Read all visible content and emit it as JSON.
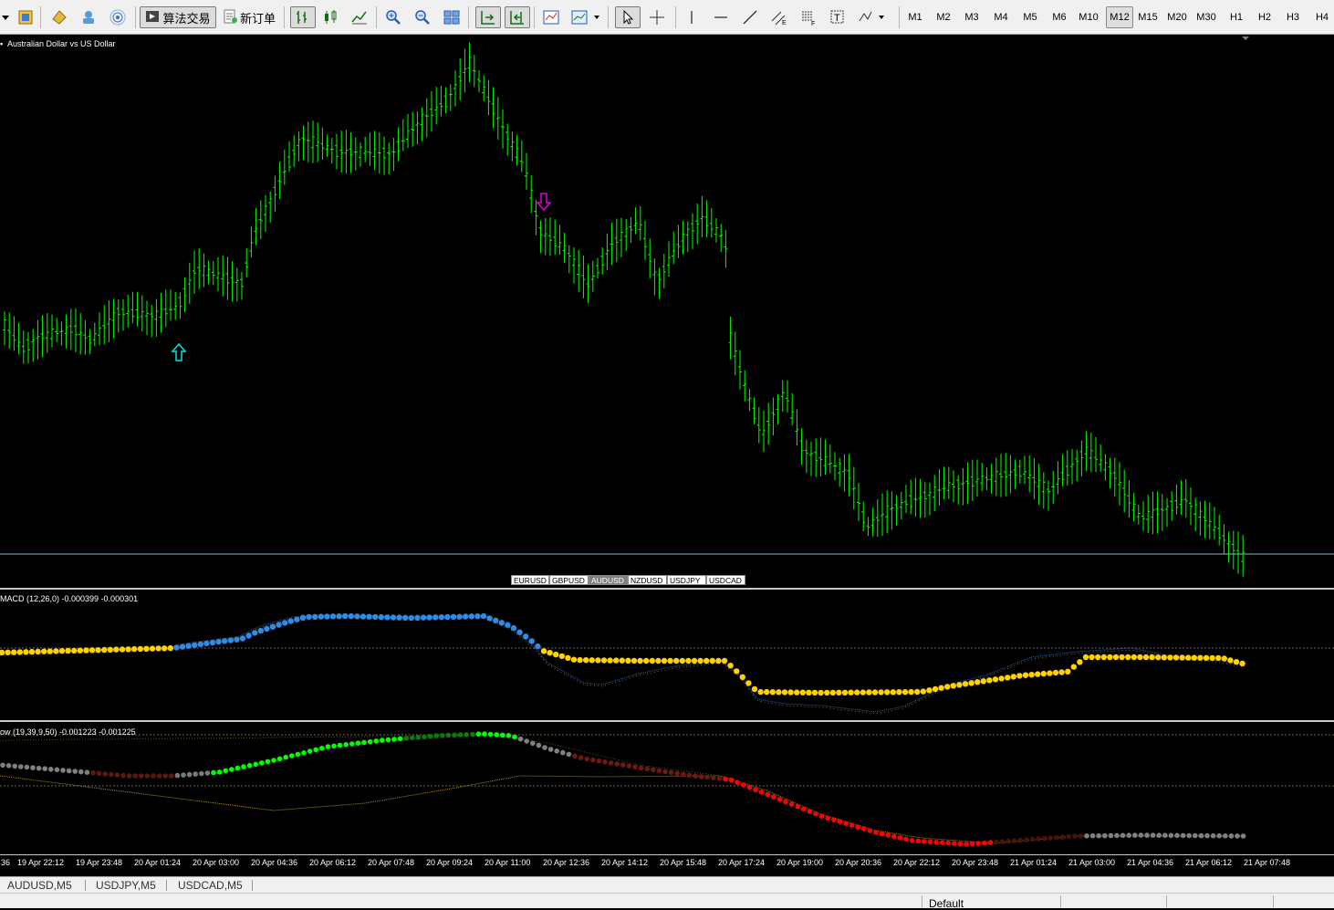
{
  "toolbar": {
    "algo_trading_label": "算法交易",
    "new_order_label": "新订单",
    "timeframes": [
      "M1",
      "M2",
      "M3",
      "M4",
      "M5",
      "M6",
      "M10",
      "M12",
      "M15",
      "M20",
      "M30",
      "H1",
      "H2",
      "H3",
      "H4"
    ],
    "active_timeframe": "M12"
  },
  "chart": {
    "title": "Australian Dollar vs US Dollar",
    "symbols": [
      "EURUSD",
      "GBPUSD",
      "AUDUSD",
      "NZDUSD",
      "USDJPY",
      "USDCAD"
    ],
    "active_symbol": "AUDUSD",
    "bar_color": "#00ff00",
    "buy_arrow_color": "#00e5e5",
    "sell_arrow_color": "#e000e0"
  },
  "macd": {
    "label": "MACD (12,26,0) -0.000399 -0.000301",
    "color_pos": "#2e8ce6",
    "color_neg": "#ffd200"
  },
  "indicator2": {
    "label": "ow (19,39,9,50) -0.001223 -0.001225",
    "color_up": "#00ff00",
    "color_down": "#ff0000",
    "color_neutral": "#808080"
  },
  "time_axis": [
    "36",
    "19 Apr 22:12",
    "19 Apr 23:48",
    "20 Apr 01:24",
    "20 Apr 03:00",
    "20 Apr 04:36",
    "20 Apr 06:12",
    "20 Apr 07:48",
    "20 Apr 09:24",
    "20 Apr 11:00",
    "20 Apr 12:36",
    "20 Apr 14:12",
    "20 Apr 15:48",
    "20 Apr 17:24",
    "20 Apr 19:00",
    "20 Apr 20:36",
    "20 Apr 22:12",
    "20 Apr 23:48",
    "21 Apr 01:24",
    "21 Apr 03:00",
    "21 Apr 04:36",
    "21 Apr 06:12",
    "21 Apr 07:48"
  ],
  "chart_tabs": [
    "AUDUSD,M5",
    "USDJPY,M5",
    "USDCAD,M5"
  ],
  "status": {
    "profile": "Default"
  }
}
